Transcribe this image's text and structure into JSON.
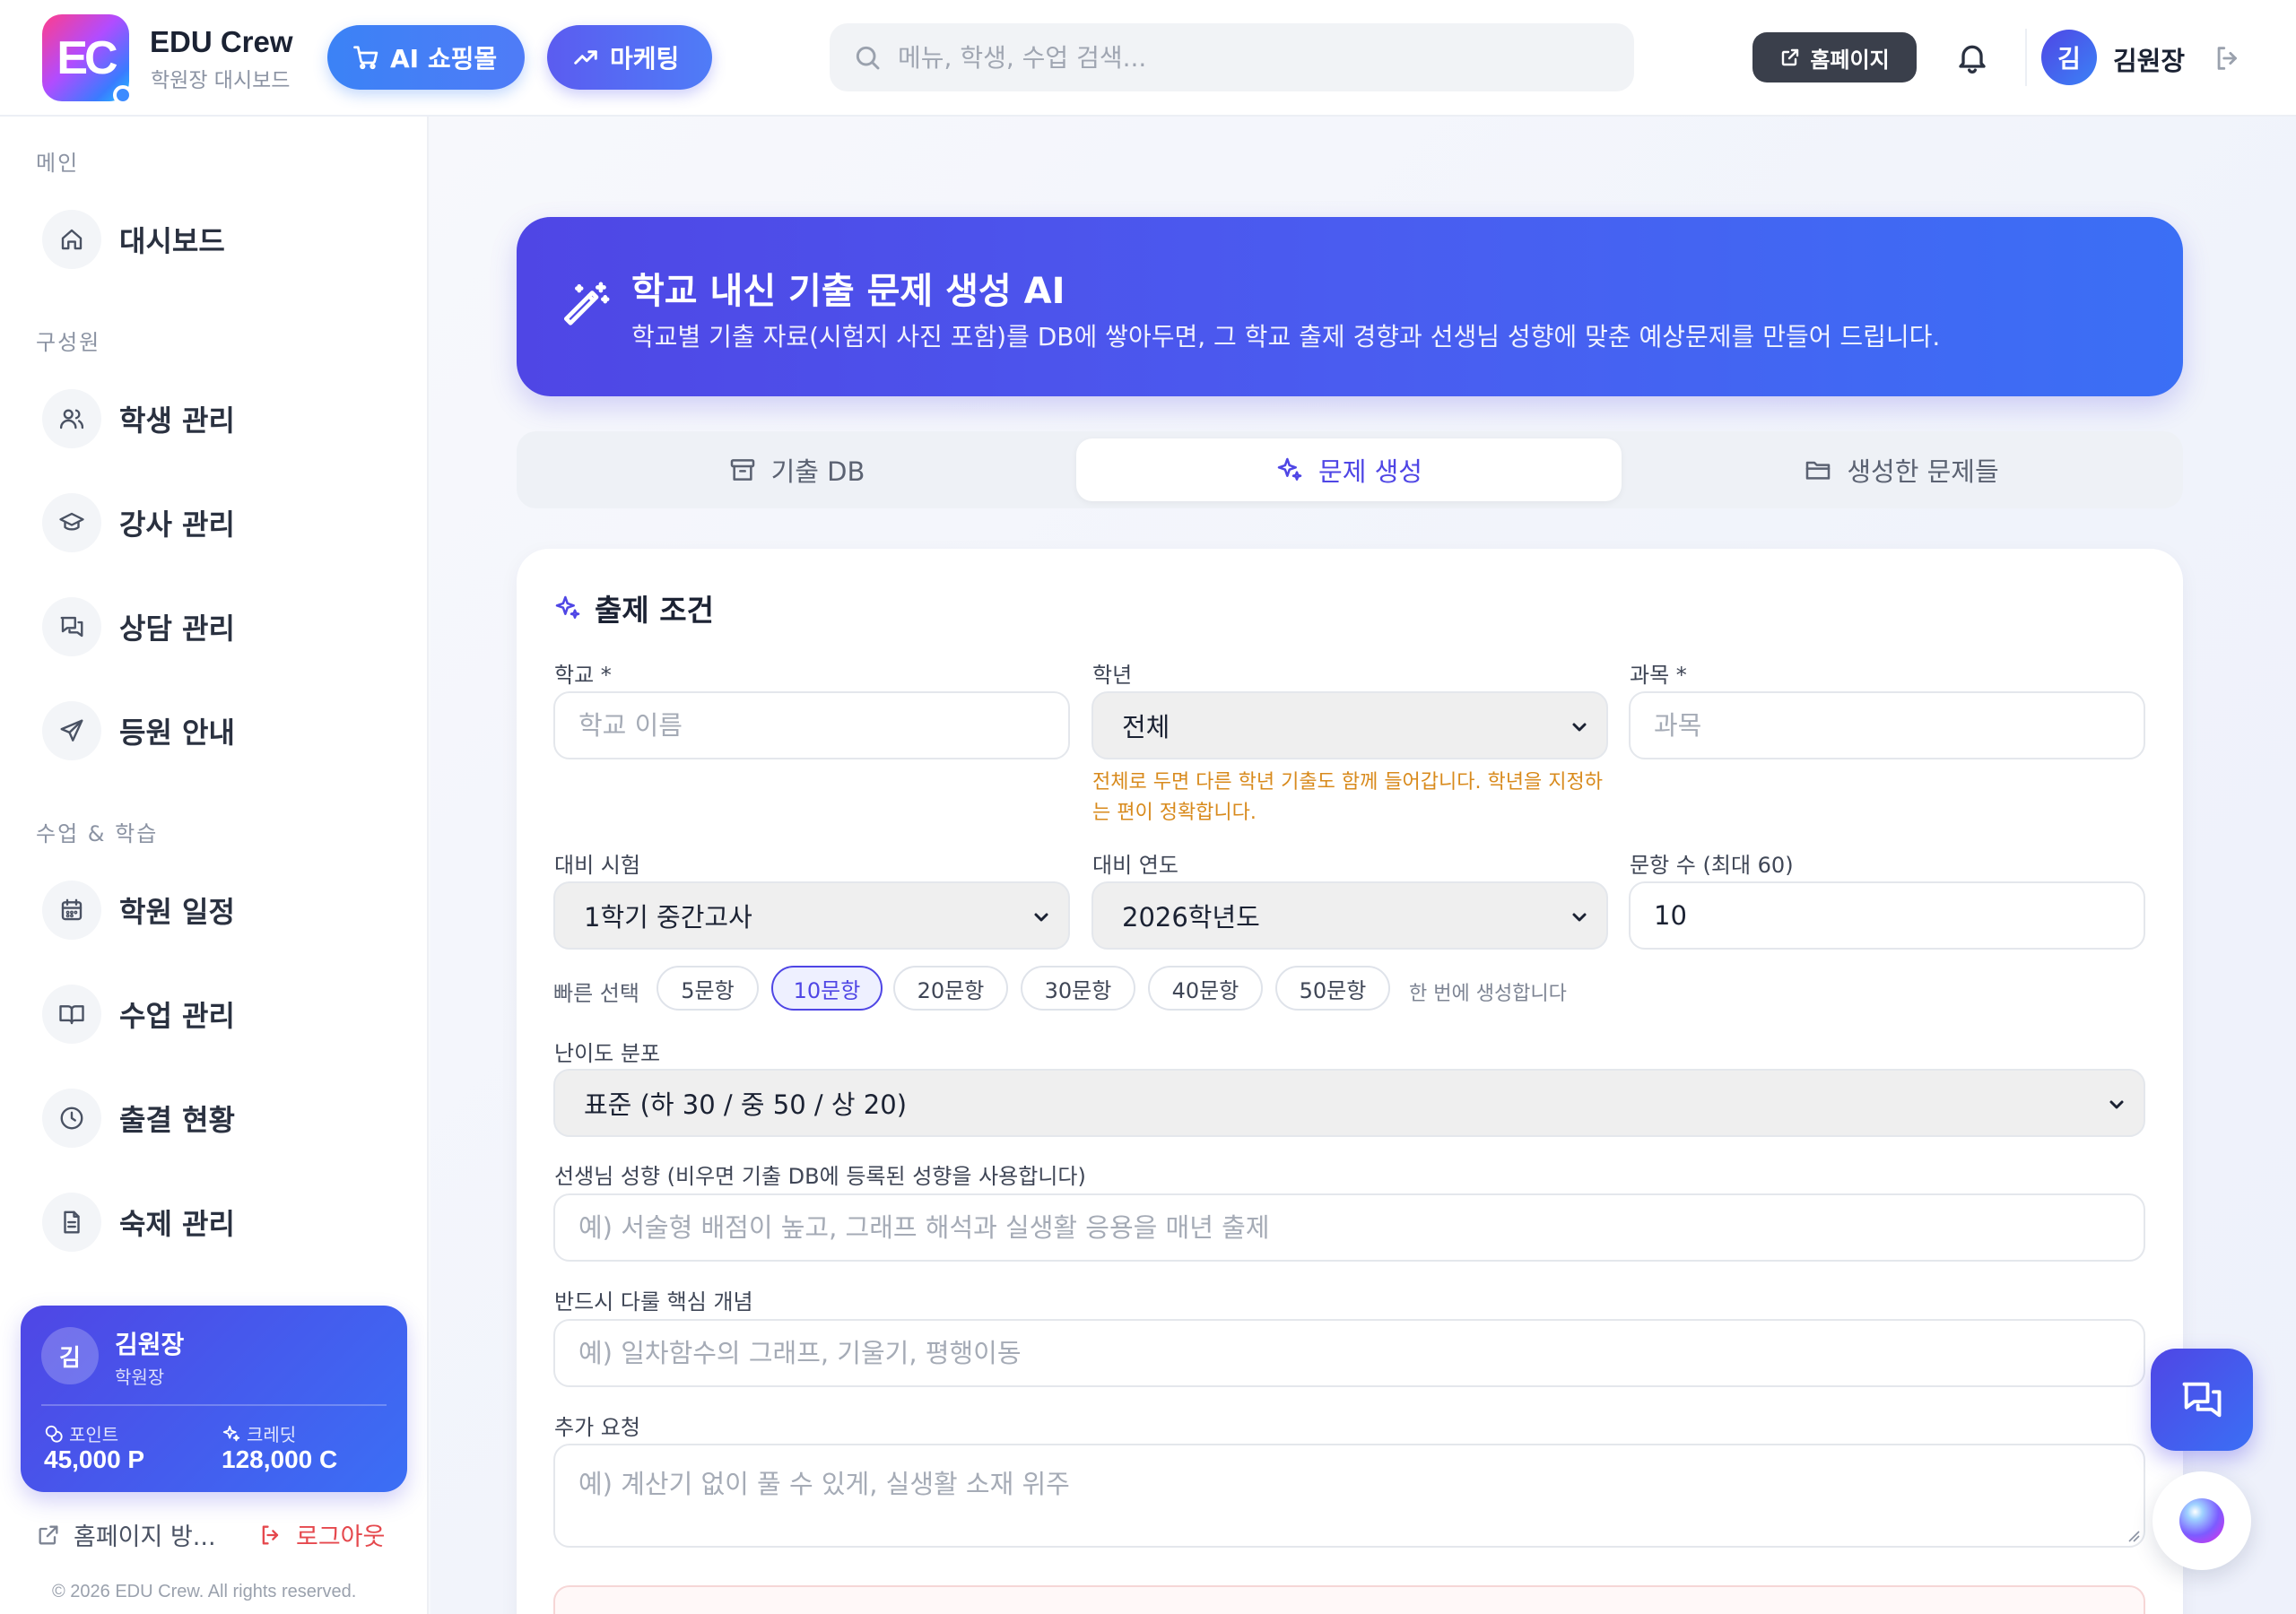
{
  "brand": {
    "logo_text": "EC",
    "name": "EDU Crew",
    "subtitle": "학원장 대시보드"
  },
  "header": {
    "shop_button": "AI 쇼핑몰",
    "marketing_button": "마케팅",
    "search_placeholder": "메뉴, 학생, 수업 검색...",
    "homepage_button": "홈페이지",
    "avatar_initial": "김",
    "user_name": "김원장"
  },
  "sidebar": {
    "sections": [
      {
        "label": "메인",
        "items": [
          {
            "label": "대시보드",
            "icon": "home-icon"
          }
        ]
      },
      {
        "label": "구성원",
        "items": [
          {
            "label": "학생 관리",
            "icon": "users-icon"
          },
          {
            "label": "강사 관리",
            "icon": "graduation-cap-icon"
          },
          {
            "label": "상담 관리",
            "icon": "chat-icon"
          },
          {
            "label": "등원 안내",
            "icon": "send-icon"
          }
        ]
      },
      {
        "label": "수업 & 학습",
        "items": [
          {
            "label": "학원 일정",
            "icon": "calendar-icon"
          },
          {
            "label": "수업 관리",
            "icon": "book-icon"
          },
          {
            "label": "출결 현황",
            "icon": "clock-icon"
          },
          {
            "label": "숙제 관리",
            "icon": "document-icon"
          }
        ]
      }
    ],
    "profile": {
      "initial": "김",
      "name": "김원장",
      "role": "학원장",
      "points_label": "포인트",
      "points_value": "45,000 P",
      "credits_label": "크레딧",
      "credits_value": "128,000 C"
    },
    "homepage_link": "홈페이지 방...",
    "logout_link": "로그아웃",
    "copyright": "© 2026 EDU Crew. All rights reserved."
  },
  "hero": {
    "title": "학교 내신 기출 문제 생성 AI",
    "subtitle": "학교별 기출 자료(시험지 사진 포함)를 DB에 쌓아두면, 그 학교 출제 경향과 선생님 성향에 맞춘 예상문제를 만들어 드립니다."
  },
  "tabs": [
    {
      "label": "기출 DB",
      "icon": "archive-icon",
      "active": false
    },
    {
      "label": "문제 생성",
      "icon": "sparkles-icon",
      "active": true
    },
    {
      "label": "생성한 문제들",
      "icon": "folder-icon",
      "active": false
    }
  ],
  "form": {
    "title": "출제 조건",
    "school_label": "학교 *",
    "school_placeholder": "학교 이름",
    "grade_label": "학년",
    "grade_value": "전체",
    "grade_hint": "전체로 두면 다른 학년 기출도 함께 들어갑니다. 학년을 지정하는 편이 정확합니다.",
    "subject_label": "과목 *",
    "subject_placeholder": "과목",
    "exam_label": "대비 시험",
    "exam_value": "1학기 중간고사",
    "year_label": "대비 연도",
    "year_value": "2026학년도",
    "count_label": "문항 수 (최대 60)",
    "count_value": "10",
    "quick_label": "빠른 선택",
    "quick_options": [
      "5문항",
      "10문항",
      "20문항",
      "30문항",
      "40문항",
      "50문항"
    ],
    "quick_selected": "10문항",
    "quick_note": "한 번에 생성합니다",
    "difficulty_label": "난이도 분포",
    "difficulty_value": "표준 (하 30 / 중 50 / 상 20)",
    "teacher_label": "선생님 성향 (비우면 기출 DB에 등록된 성향을 사용합니다)",
    "teacher_placeholder": "예) 서술형 배점이 높고, 그래프 해석과 실생활 응용을 매년 출제",
    "concept_label": "반드시 다룰 핵심 개념",
    "concept_placeholder": "예) 일차함수의 그래프, 기울기, 평행이동",
    "extra_label": "추가 요청",
    "extra_placeholder": "예) 계산기 없이 풀 수 있게, 실생활 소재 위주"
  },
  "colors": {
    "primary": "#4f46e5",
    "accent_blue": "#3b82f6",
    "warning_text": "#d88a1c",
    "logout_red": "#e5484d"
  }
}
